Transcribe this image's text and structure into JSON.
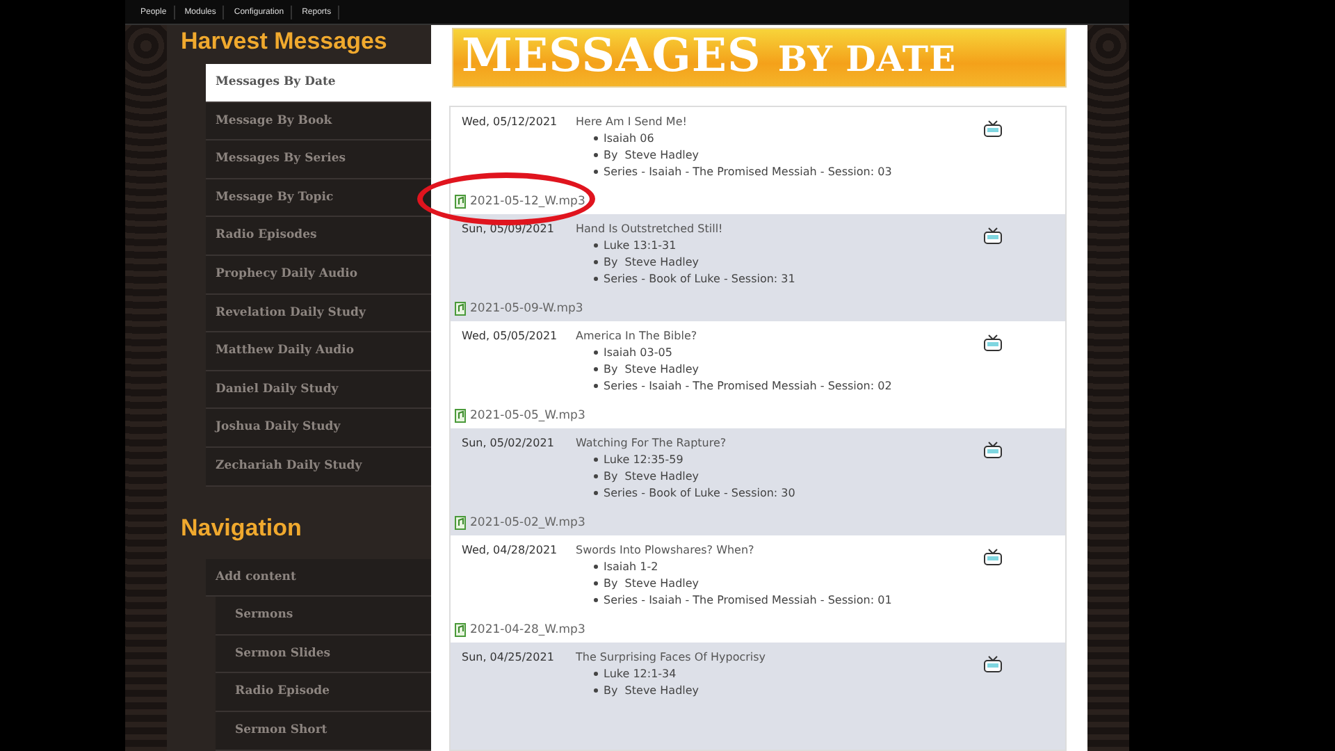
{
  "top_menu": [
    {
      "label": "People"
    },
    {
      "label": "Modules"
    },
    {
      "label": "Configuration"
    },
    {
      "label": "Reports"
    }
  ],
  "sidebar": {
    "title": "Harvest Messages",
    "items": [
      {
        "label": "Messages By Date",
        "selected": true
      },
      {
        "label": "Message By Book",
        "selected": false
      },
      {
        "label": "Messages By Series",
        "selected": false
      },
      {
        "label": "Message By Topic",
        "selected": false
      },
      {
        "label": "Radio Episodes",
        "selected": false
      },
      {
        "label": "Prophecy Daily Audio",
        "selected": false
      },
      {
        "label": "Revelation Daily Study",
        "selected": false
      },
      {
        "label": "Matthew Daily Audio",
        "selected": false
      },
      {
        "label": "Daniel Daily Study",
        "selected": false
      },
      {
        "label": "Joshua Daily Study",
        "selected": false
      },
      {
        "label": "Zechariah Daily Study",
        "selected": false
      }
    ]
  },
  "navigation": {
    "title": "Navigation",
    "items": [
      {
        "label": "Add content",
        "children": [
          {
            "label": "Sermons"
          },
          {
            "label": "Sermon Slides"
          },
          {
            "label": "Radio Episode"
          },
          {
            "label": "Sermon Short"
          }
        ]
      }
    ]
  },
  "banner": {
    "title": "MESSAGES",
    "small": "BY DATE"
  },
  "messages": [
    {
      "date": "Wed, 05/12/2021",
      "title": "Here Am I Send Me!",
      "details": [
        "Isaiah 06",
        "By  Steve Hadley",
        "Series - Isaiah - The Promised Messiah - Session: 03"
      ],
      "file": "2021-05-12_W.mp3",
      "circled": true
    },
    {
      "date": "Sun, 05/09/2021",
      "title": "Hand Is Outstretched Still!",
      "details": [
        "Luke 13:1-31",
        "By  Steve Hadley",
        "Series - Book of Luke - Session: 31"
      ],
      "file": "2021-05-09-W.mp3",
      "circled": false
    },
    {
      "date": "Wed, 05/05/2021",
      "title": "America In The Bible?",
      "details": [
        "Isaiah 03-05",
        "By  Steve Hadley",
        "Series - Isaiah - The Promised Messiah - Session: 02"
      ],
      "file": "2021-05-05_W.mp3",
      "circled": false
    },
    {
      "date": "Sun, 05/02/2021",
      "title": "Watching For The Rapture?",
      "details": [
        "Luke 12:35-59",
        "By  Steve Hadley",
        "Series - Book of Luke - Session: 30"
      ],
      "file": "2021-05-02_W.mp3",
      "circled": false
    },
    {
      "date": "Wed, 04/28/2021",
      "title": "Swords Into Plowshares? When?",
      "details": [
        "Isaiah 1-2",
        "By  Steve Hadley",
        "Series - Isaiah - The Promised Messiah - Session: 01"
      ],
      "file": "2021-04-28_W.mp3",
      "circled": false
    },
    {
      "date": "Sun, 04/25/2021",
      "title": "The Surprising Faces Of Hypocrisy",
      "details": [
        "Luke 12:1-34",
        "By  Steve Hadley"
      ],
      "circled": false
    }
  ]
}
